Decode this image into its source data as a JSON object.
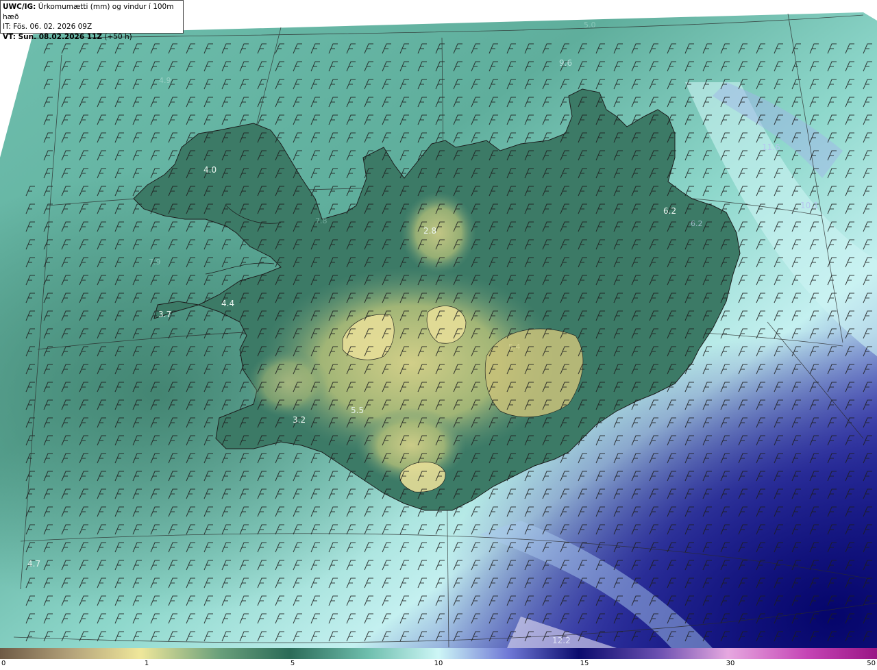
{
  "header": {
    "product": "UWC/IG:",
    "title": "Úrkomumætti (mm) og vindur í 100m hæð",
    "issue_time": "IT: Fös. 06. 02. 2026 09Z",
    "valid_time_label": "VT: Sun. 08.02.2026 11Z",
    "lead_time": "(+50 h)"
  },
  "map": {
    "region": "Iceland",
    "value_labels": [
      "4.0",
      "2.8",
      "6.2",
      "9.6",
      "11.6",
      "10.1",
      "4.4",
      "3.7",
      "5.5",
      "3.2",
      "4.7",
      "12.2"
    ],
    "faint_labels": [
      "4.9",
      "5.0",
      "6.2",
      "9.6",
      "7.9",
      "5.4",
      "7.8"
    ]
  },
  "legend": {
    "ticks": [
      "0",
      "1",
      "5",
      "10",
      "15",
      "30",
      "50"
    ]
  },
  "colors": {
    "low": "#7a6a52",
    "yellow": "#e6dd8e",
    "green": "#2c6e5a",
    "teal": "#7ccabd",
    "cyan": "#c8f4f4",
    "blue": "#2c2ea0",
    "navy": "#0b0b6e",
    "pink": "#d98ad0",
    "magenta": "#b01a98",
    "coast": "#1c1c1c"
  }
}
